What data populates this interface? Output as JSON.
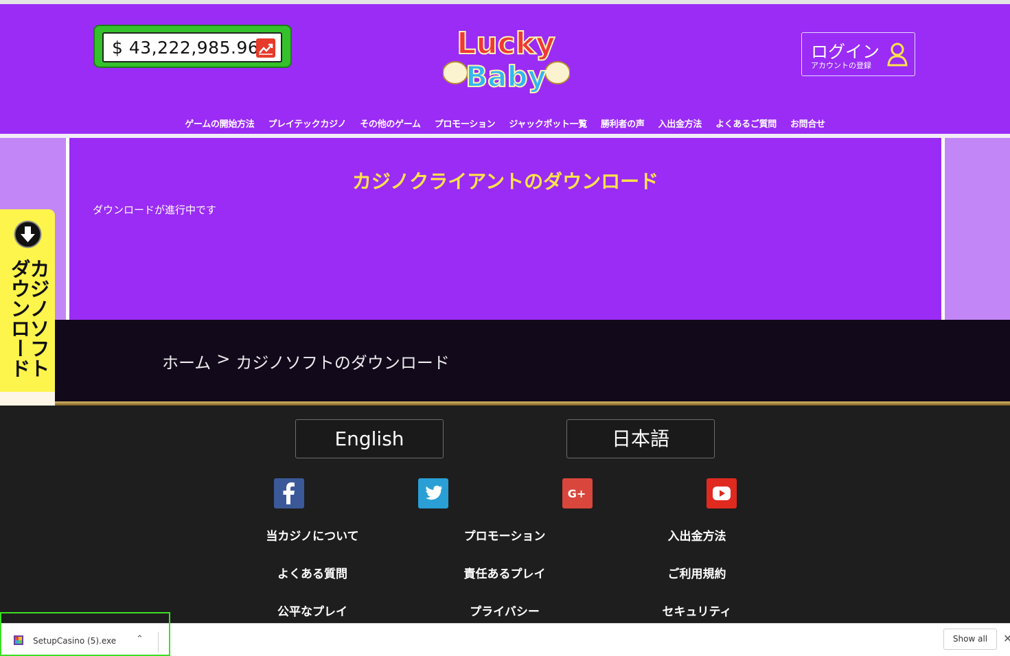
{
  "header": {
    "jackpot": {
      "value": "$ 43,222,985.96",
      "icon": "chart-up-icon"
    },
    "logo": {
      "text_line1": "Lucky",
      "text_line2": "Baby",
      "icon": "winged-logo"
    },
    "login": {
      "label": "ログイン",
      "sublabel": "アカウントの登録",
      "icon": "user-icon"
    },
    "nav": [
      "ゲームの開始方法",
      "プレイテックカジノ",
      "その他のゲーム",
      "プロモーション",
      "ジャックポット一覧",
      "勝利者の声",
      "入出金方法",
      "よくあるご質問",
      "お問合せ"
    ]
  },
  "content": {
    "title": "カジノクライアントのダウンロード",
    "status": "ダウンロードが進行中です"
  },
  "breadcrumb": {
    "home": "ホーム",
    "separator": ">",
    "current": "カジノソフトのダウンロード"
  },
  "side_tab": {
    "label": "カジノソフトダウンロード",
    "icon": "download-arrow-icon"
  },
  "footer": {
    "languages": [
      "English",
      "日本語"
    ],
    "social": [
      "facebook-icon",
      "twitter-icon",
      "google-plus-icon",
      "youtube-icon"
    ],
    "links": [
      [
        "当カジノについて",
        "プロモーション",
        "入出金方法"
      ],
      [
        "よくある質問",
        "責任あるプレイ",
        "ご利用規約"
      ],
      [
        "公平なプレイ",
        "プライバシー",
        "セキュリティ"
      ]
    ]
  },
  "download_shelf": {
    "file_name": "SetupCasino (5).exe",
    "show_all": "Show all",
    "close": "✕"
  },
  "colors": {
    "header_purple": "#9a2cf6",
    "title_yellow": "#ffe34a",
    "jackpot_green": "#35c12b",
    "side_tab_yellow": "#fdf44c",
    "highlight_green": "#3ce023"
  }
}
